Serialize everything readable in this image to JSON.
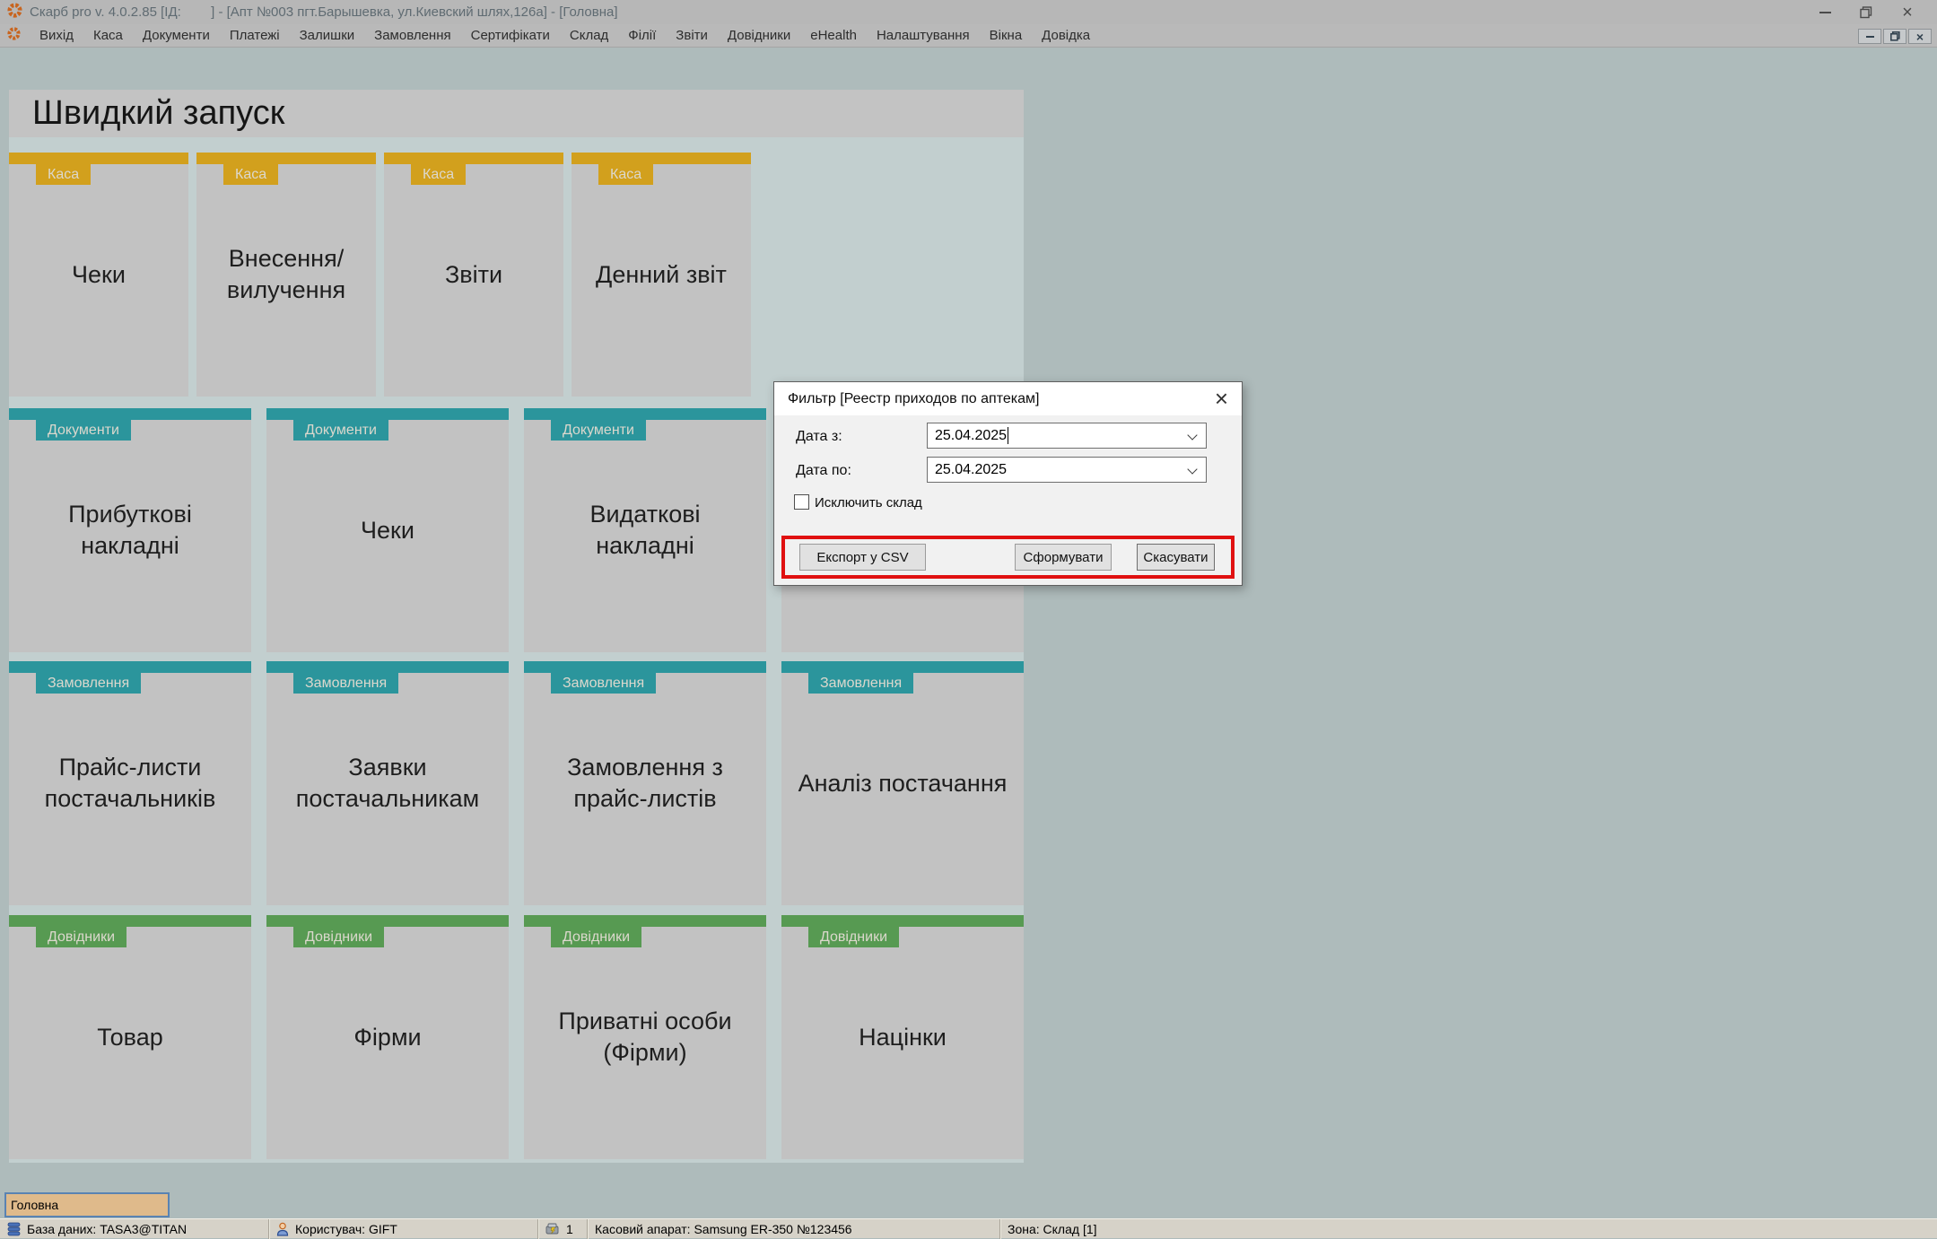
{
  "titlebar": {
    "title": "Скарб pro v. 4.0.2.85 [ІД:        ] - [Апт №003 пгт.Барышевка, ул.Киевский шлях,126а] - [Головна]"
  },
  "menubar": {
    "items": [
      "Вихід",
      "Каса",
      "Документи",
      "Платежі",
      "Залишки",
      "Замовлення",
      "Сертифікати",
      "Склад",
      "Філії",
      "Звіти",
      "Довідники",
      "eHealth",
      "Налаштування",
      "Вікна",
      "Довідка"
    ]
  },
  "quick_launch": {
    "title": "Швидкий запуск",
    "rows": [
      {
        "category": "Каса",
        "color": "#d2a01d",
        "tiles": [
          "Чеки",
          "Внесення/вилучення",
          "Звіти",
          "Денний звіт"
        ]
      },
      {
        "category": "Документи",
        "color": "#2b959c",
        "tiles": [
          "Прибуткові накладні",
          "Чеки",
          "Видаткові накладні",
          ""
        ]
      },
      {
        "category": "Замовлення",
        "color": "#2b959c",
        "tiles": [
          "Прайс-листи постачальників",
          "Заявки постачальникам",
          "Замовлення з прайс-листів",
          "Аналіз постачання"
        ]
      },
      {
        "category": "Довідники",
        "color": "#579a52",
        "tiles": [
          "Товар",
          "Фірми",
          "Приватні особи (Фірми)",
          "Націнки"
        ]
      }
    ]
  },
  "dialog": {
    "title": "Фильтр [Реестр приходов по аптекам]",
    "close_glyph": "×",
    "fields": [
      {
        "label": "Дата з:",
        "value": "25.04.2025"
      },
      {
        "label": "Дата по:",
        "value": "25.04.2025"
      }
    ],
    "checkbox_label": "Исключить склад",
    "checkbox_checked": "false",
    "buttons": {
      "export": "Експорт у CSV",
      "generate": "Сформувати",
      "cancel": "Скасувати"
    },
    "highlight_color": "#e01010"
  },
  "tabs": {
    "active": "Головна"
  },
  "statusbar": {
    "database": "База даних: TASA3@TITAN",
    "user": "Користувач: GIFT",
    "register_count": "1",
    "cash_register": "Касовий апарат: Samsung ER-350 №123456",
    "zone": "Зона: Склад [1]"
  },
  "colors": {
    "kasa_orange": "#d2a01d",
    "docs_teal": "#2b959c",
    "guides_green": "#579a52",
    "highlight_red": "#e01010",
    "tab_tan": "#dfba8b",
    "desktop": "#aebbbb"
  }
}
